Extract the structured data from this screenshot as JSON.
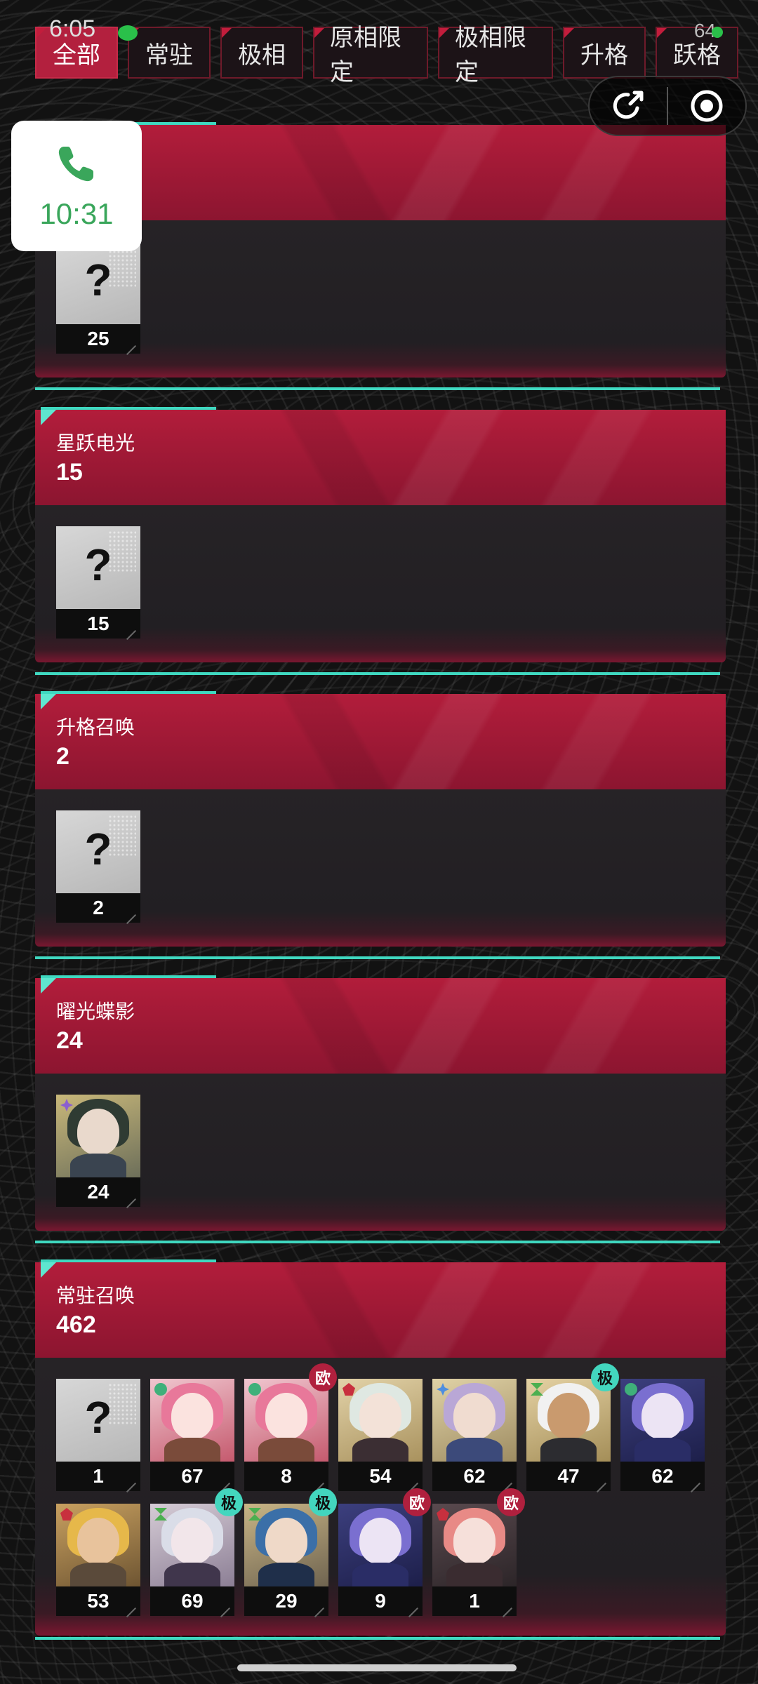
{
  "status_bar": {
    "time": "6:05",
    "battery": "64"
  },
  "tabs": [
    {
      "label": "全部",
      "active": true
    },
    {
      "label": "常驻",
      "active": false
    },
    {
      "label": "极相",
      "active": false
    },
    {
      "label": "原相限定",
      "active": false
    },
    {
      "label": "极相限定",
      "active": false
    },
    {
      "label": "升格",
      "active": false
    },
    {
      "label": "跃格",
      "active": false
    }
  ],
  "call_widget": {
    "time": "10:31",
    "icon": "phone-icon"
  },
  "capsule": {
    "share_icon": "share-icon",
    "close_icon": "target-icon"
  },
  "sections": [
    {
      "title": "",
      "count": "",
      "cards": [
        {
          "num": "25",
          "type": "unknown",
          "mark": "?"
        }
      ]
    },
    {
      "title": "星跃电光",
      "count": "15",
      "cards": [
        {
          "num": "15",
          "type": "unknown",
          "mark": "?"
        }
      ]
    },
    {
      "title": "升格召唤",
      "count": "2",
      "cards": [
        {
          "num": "2",
          "type": "unknown",
          "mark": "?"
        }
      ]
    },
    {
      "title": "曜光蝶影",
      "count": "24",
      "cards": [
        {
          "num": "24",
          "type": "char",
          "palette": "dark-green"
        }
      ]
    },
    {
      "title": "常驻召唤",
      "count": "462",
      "cards": [
        {
          "num": "1",
          "type": "unknown",
          "mark": "?"
        },
        {
          "num": "67",
          "type": "char",
          "palette": "pink"
        },
        {
          "num": "8",
          "type": "char",
          "palette": "pink",
          "badge": "欧",
          "badge_color": "red"
        },
        {
          "num": "54",
          "type": "char",
          "palette": "white-green"
        },
        {
          "num": "62",
          "type": "char",
          "palette": "lilac"
        },
        {
          "num": "47",
          "type": "char",
          "palette": "white-tan",
          "badge": "极",
          "badge_color": "teal"
        },
        {
          "num": "62",
          "type": "char",
          "palette": "blue-violet"
        },
        {
          "num": "53",
          "type": "char",
          "palette": "blonde"
        },
        {
          "num": "69",
          "type": "char",
          "palette": "silver",
          "badge": "极",
          "badge_color": "teal"
        },
        {
          "num": "29",
          "type": "char",
          "palette": "blue-hair",
          "badge": "极",
          "badge_color": "teal"
        },
        {
          "num": "9",
          "type": "char",
          "palette": "blue-violet",
          "badge": "欧",
          "badge_color": "red"
        },
        {
          "num": "1",
          "type": "char",
          "palette": "salmon",
          "badge": "欧",
          "badge_color": "red"
        }
      ]
    }
  ],
  "colors": {
    "accent_red": "#b3203e",
    "accent_teal": "#3fd8c0",
    "card_bg": "#262326"
  }
}
